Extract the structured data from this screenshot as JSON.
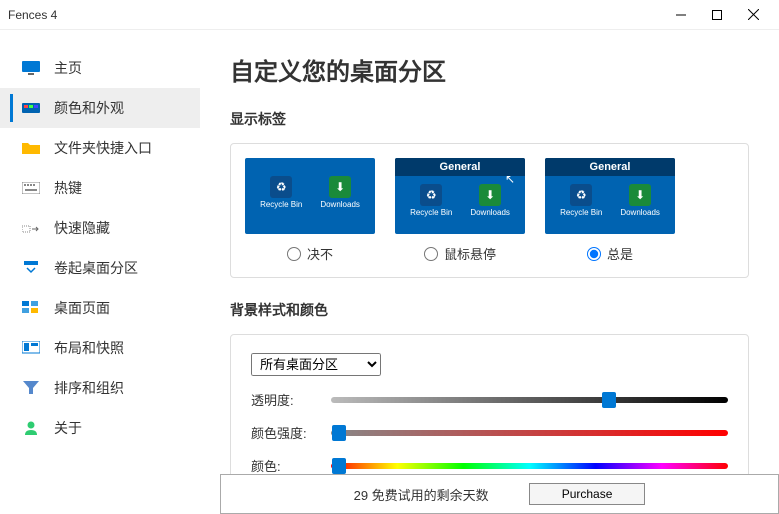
{
  "window": {
    "title": "Fences 4"
  },
  "sidebar": {
    "items": [
      {
        "label": "主页"
      },
      {
        "label": "颜色和外观"
      },
      {
        "label": "文件夹快捷入口"
      },
      {
        "label": "热键"
      },
      {
        "label": "快速隐藏"
      },
      {
        "label": "卷起桌面分区"
      },
      {
        "label": "桌面页面"
      },
      {
        "label": "布局和快照"
      },
      {
        "label": "排序和组织"
      },
      {
        "label": "关于"
      }
    ]
  },
  "main": {
    "heading": "自定义您的桌面分区",
    "show_labels": {
      "title": "显示标签",
      "preview": {
        "fence_title": "General",
        "icons": [
          {
            "name": "Recycle Bin"
          },
          {
            "name": "Downloads"
          }
        ]
      },
      "options": {
        "never": "决不",
        "hover": "鼠标悬停",
        "always": "总是",
        "selected": "always"
      }
    },
    "bg_style": {
      "title": "背景样式和颜色",
      "scope": {
        "selected": "所有桌面分区"
      },
      "sliders": {
        "opacity": {
          "label": "透明度:",
          "value": 70
        },
        "intensity": {
          "label": "颜色强度:",
          "value": 2
        },
        "hue": {
          "label": "颜色:",
          "value": 2
        }
      }
    },
    "trial": {
      "text": "29 免费试用的剩余天数",
      "button": "Purchase"
    }
  }
}
